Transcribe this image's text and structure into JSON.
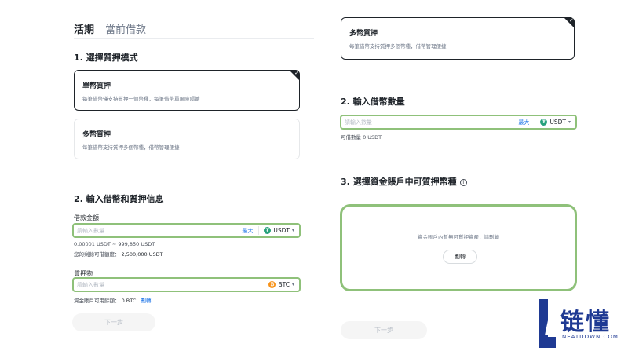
{
  "tabs": [
    {
      "label": "活期",
      "active": true
    },
    {
      "label": "當前借款",
      "active": false
    }
  ],
  "left": {
    "step1_title": "1. 選擇質押模式",
    "single_mode": {
      "title": "單幣質押",
      "desc": "每筆借幣僅支持質押一個幣種，每筆借幣單風險隔離",
      "selected": true
    },
    "multi_mode": {
      "title": "多幣質押",
      "desc": "每筆借幣支持質押多個幣種，借幣管理便捷",
      "selected": false
    },
    "step2_title": "2. 輸入借幣和質押信息",
    "borrow": {
      "label": "借款金額",
      "placeholder": "請輸入數量",
      "max_label": "最大",
      "coin": "USDT",
      "range": "0.00001 USDT ~ 999,850 USDT",
      "remaining_label": "您的剩餘可借額度：",
      "remaining_value": "2,500,000 USDT"
    },
    "collateral": {
      "label": "質押物",
      "placeholder": "請輸入數量",
      "coin": "BTC",
      "available_label": "資金賬戶可用餘額：",
      "available_value": "0 BTC",
      "transfer_link": "劃轉"
    },
    "next_label": "下一步"
  },
  "right": {
    "multi_mode": {
      "title": "多幣質押",
      "desc": "每筆借幣支持質押多個幣種，借幣管理便捷",
      "selected": true
    },
    "step2_title": "2. 輸入借幣數量",
    "borrow": {
      "placeholder": "請輸入數量",
      "max_label": "最大",
      "coin": "USDT",
      "available": "可借數量 0 USDT"
    },
    "step3_title": "3. 選擇資金賬戶中可質押幣種",
    "assets_empty_msg": "資金賬戶內暫無可質押資產，請劃轉",
    "refresh_label": "劃轉",
    "next_label": "下一步"
  },
  "watermark": {
    "cn": "链懂",
    "en": "NEATDOWN.COM"
  },
  "colors": {
    "highlight": "#8fc17a",
    "link": "#1a73e8",
    "usdt": "#26a17b",
    "btc": "#f7931a",
    "brand": "#1f3a93"
  }
}
